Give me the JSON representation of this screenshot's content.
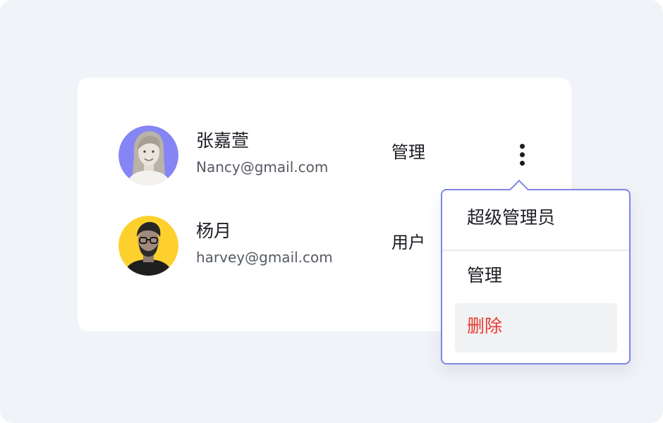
{
  "users": [
    {
      "name": "张嘉萱",
      "email": "Nancy@gmail.com",
      "role": "管理",
      "avatar_bg": "#8585f5",
      "avatar_icon": "woman-portrait"
    },
    {
      "name": "杨月",
      "email": "harvey@gmail.com",
      "role": "用户",
      "avatar_bg": "#fdd02e",
      "avatar_icon": "man-portrait"
    }
  ],
  "row_actions": {
    "icon": "more-vertical-icon"
  },
  "role_menu": {
    "items": [
      {
        "label": "超级管理员"
      },
      {
        "label": "管理"
      },
      {
        "label": "删除",
        "color": "#e63a31",
        "highlighted": true
      }
    ],
    "border_color": "#7d86e0"
  },
  "colors": {
    "page_background": "#f0f3f7",
    "card_background": "#ffffff",
    "danger": "#e63a31"
  }
}
